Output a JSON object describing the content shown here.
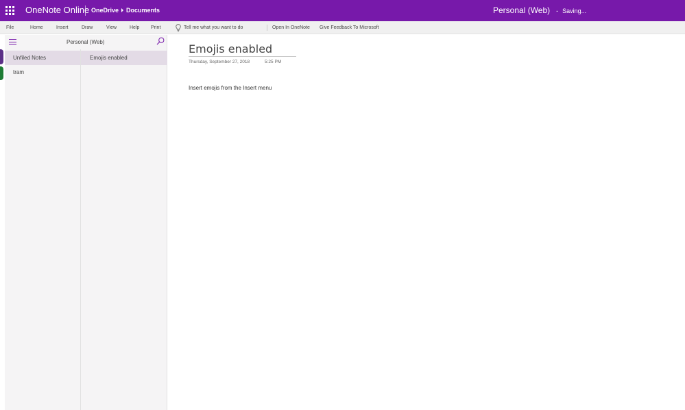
{
  "topbar": {
    "app_title": "OneNote Online",
    "breadcrumb": [
      "OneDrive",
      "Documents"
    ],
    "notebook_name": "Personal (Web)",
    "separator": "-",
    "status": "Saving...",
    "brand_color": "#7719aa"
  },
  "menubar": {
    "items": [
      "File",
      "Home",
      "Insert",
      "Draw",
      "View",
      "Help",
      "Print"
    ],
    "tell_me": "Tell me what you want to do",
    "open_in_onenote": "Open In OneNote",
    "feedback": "Give Feedback To Microsoft"
  },
  "nav": {
    "notebook_title": "Personal (Web)",
    "sections": [
      {
        "label": "Unfiled Notes",
        "selected": true
      },
      {
        "label": "tram",
        "selected": false
      }
    ],
    "pages": [
      {
        "label": "Emojis enabled",
        "selected": true
      }
    ],
    "icons": [
      "hamburger-icon",
      "search-icon"
    ]
  },
  "page": {
    "title": "Emojis enabled",
    "date": "Thursday, September 27, 2018",
    "time": "5:25 PM",
    "body": "Insert emojis from the Insert menu"
  }
}
